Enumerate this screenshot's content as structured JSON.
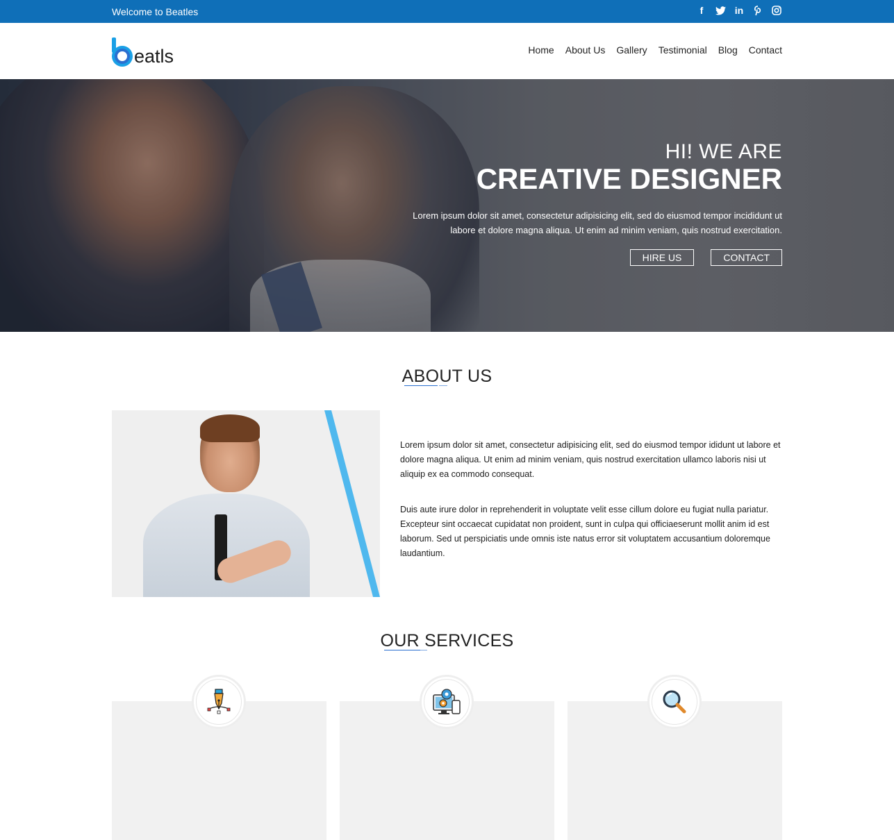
{
  "topbar": {
    "welcome": "Welcome to Beatles",
    "social": [
      "facebook-icon",
      "twitter-icon",
      "linkedin-icon",
      "pinterest-icon",
      "instagram-icon"
    ]
  },
  "header": {
    "logo_text": "eatls",
    "nav": [
      "Home",
      "About Us",
      "Gallery",
      "Testimonial",
      "Blog",
      "Contact"
    ]
  },
  "hero": {
    "kicker": "HI! WE ARE",
    "title": "CREATIVE DESIGNER",
    "description": "Lorem ipsum dolor sit amet, consectetur adipisicing elit, sed do eiusmod tempor incididunt ut labore et dolore magna aliqua. Ut enim ad minim veniam, quis nostrud exercitation.",
    "hire_label": "HIRE US",
    "contact_label": "CONTACT"
  },
  "about": {
    "title": "ABOUT US",
    "paragraph1": "Lorem ipsum dolor sit amet, consectetur adipisicing elit, sed do eiusmod tempor ididunt ut labore et dolore magna aliqua. Ut enim ad minim veniam, quis nostrud exercitation ullamco laboris nisi ut aliquip ex ea commodo consequat.",
    "paragraph2": "Duis aute irure dolor in reprehenderit in voluptate velit esse cillum dolore eu fugiat nulla pariatur. Excepteur sint occaecat cupidatat non proident, sunt in culpa qui officiaeserunt mollit anim id est laborum. Sed ut perspiciatis unde omnis iste natus error sit voluptatem accusantium doloremque laudantium."
  },
  "services": {
    "title": "OUR SERVICES",
    "items": [
      {
        "icon": "pen-tool-icon"
      },
      {
        "icon": "devices-settings-icon"
      },
      {
        "icon": "magnifier-icon"
      }
    ]
  },
  "colors": {
    "topbar": "#0f6fb8",
    "accent": "#1aa0e6",
    "stripe": "#4fb8ee",
    "card": "#f1f1f1"
  }
}
